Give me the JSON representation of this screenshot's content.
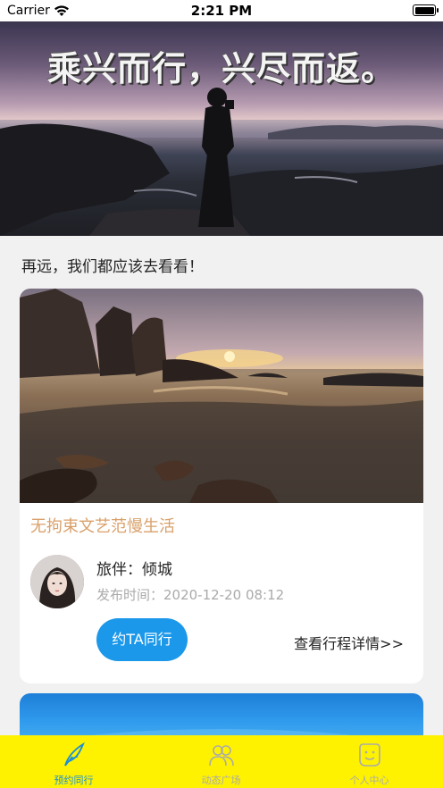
{
  "status_bar": {
    "carrier": "Carrier",
    "time": "2:21 PM"
  },
  "hero": {
    "slogan": "乘兴而行，兴尽而返。"
  },
  "intro": "再远，我们都应该去看看！",
  "card": {
    "title": "无拘束文艺范慢生活",
    "companion": "旅伴：倾城",
    "publish_time": "发布时间：2020-12-20 08:12",
    "invite_label": "约TA同行",
    "detail_link": "查看行程详情>>"
  },
  "tabs": [
    {
      "label": "预约同行",
      "icon": "feather-icon",
      "active": true
    },
    {
      "label": "动态广场",
      "icon": "people-icon",
      "active": false
    },
    {
      "label": "个人中心",
      "icon": "face-icon",
      "active": false
    }
  ],
  "colors": {
    "accent": "#1b98ea",
    "tab_active": "#1a8fd8",
    "tabbar_bg": "#fff200",
    "title_orange": "#d9a06a"
  }
}
